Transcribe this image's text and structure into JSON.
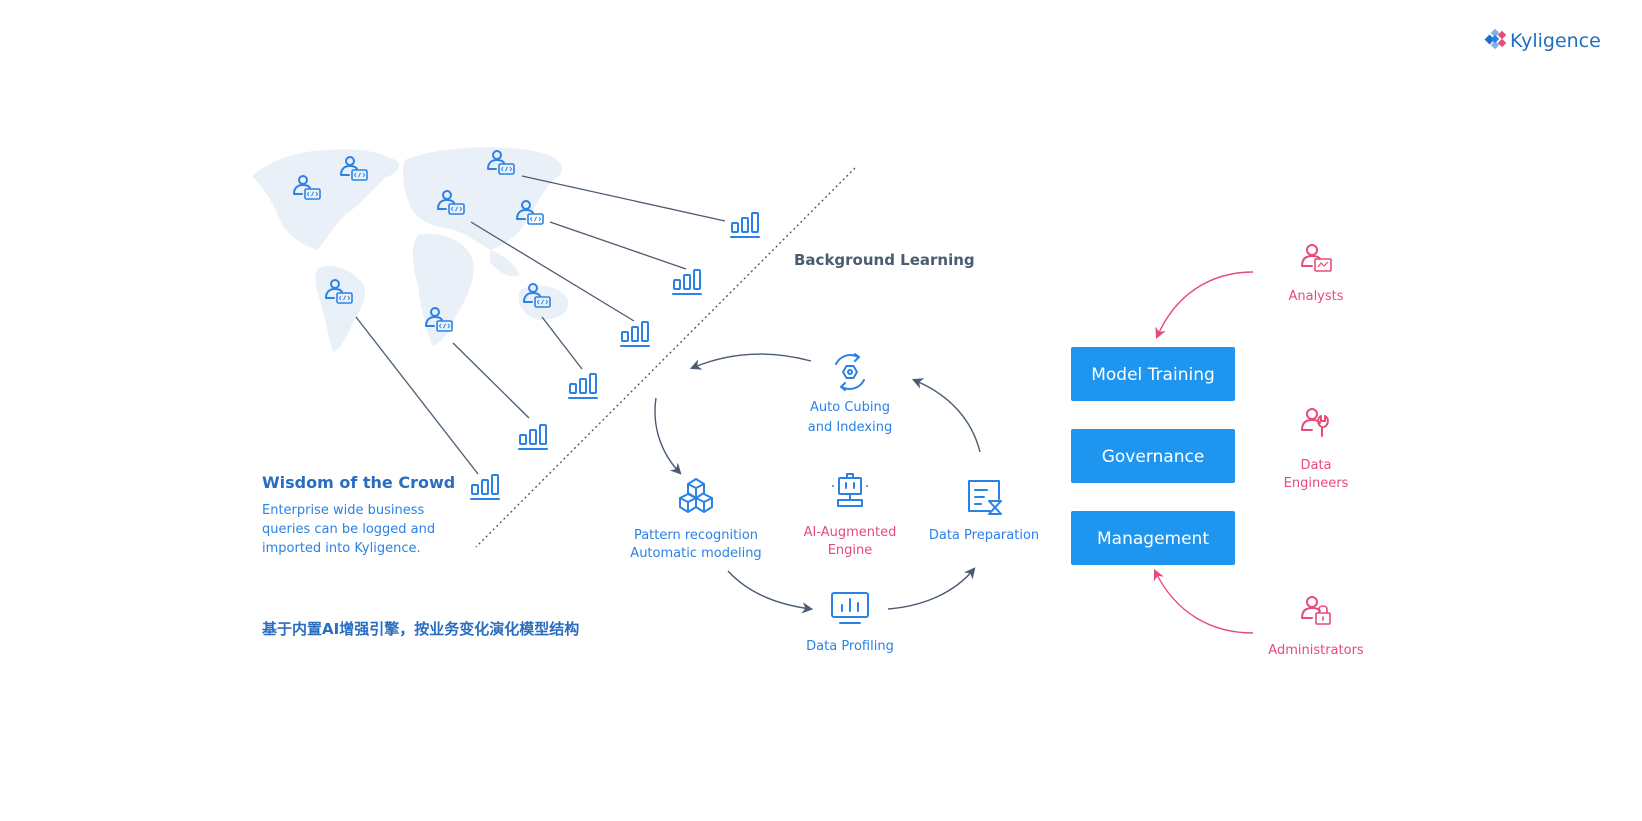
{
  "logo": {
    "text": "Kyligence"
  },
  "colors": {
    "primary": "#2b82e6",
    "box": "#1e96f0",
    "accent": "#e84a7a",
    "line": "#4a5b72",
    "map": "#eaf0f8"
  },
  "left": {
    "title": "Wisdom of the Crowd",
    "description": [
      "Enterprise wide business",
      "queries can be logged and",
      "imported into Kyligence."
    ],
    "chinese_caption": "基于内置AI增强引擎，按业务变化演化模型结构",
    "user_icon": "user-code-icon",
    "chart_icon": "bar-chart-icon"
  },
  "background_label": "Background Learning",
  "cycle": {
    "center": {
      "label": [
        "AI-Augmented",
        "Engine"
      ],
      "icon": "robot-icon"
    },
    "steps": [
      {
        "label": [
          "Auto  Cubing",
          "and Indexing"
        ],
        "icon": "gear-refresh-icon"
      },
      {
        "label": [
          "Pattern recognition",
          "Automatic modeling"
        ],
        "icon": "cubes-icon"
      },
      {
        "label": [
          "Data Profiling"
        ],
        "icon": "monitor-chart-icon"
      },
      {
        "label": [
          "Data Preparation"
        ],
        "icon": "document-hourglass-icon"
      }
    ]
  },
  "boxes": [
    "Model Training",
    "Governance",
    "Management"
  ],
  "roles": [
    {
      "label": [
        "Analysts"
      ],
      "icon": "analyst-icon"
    },
    {
      "label": [
        "Data",
        "Engineers"
      ],
      "icon": "engineer-icon"
    },
    {
      "label": [
        "Administrators"
      ],
      "icon": "admin-icon"
    }
  ]
}
